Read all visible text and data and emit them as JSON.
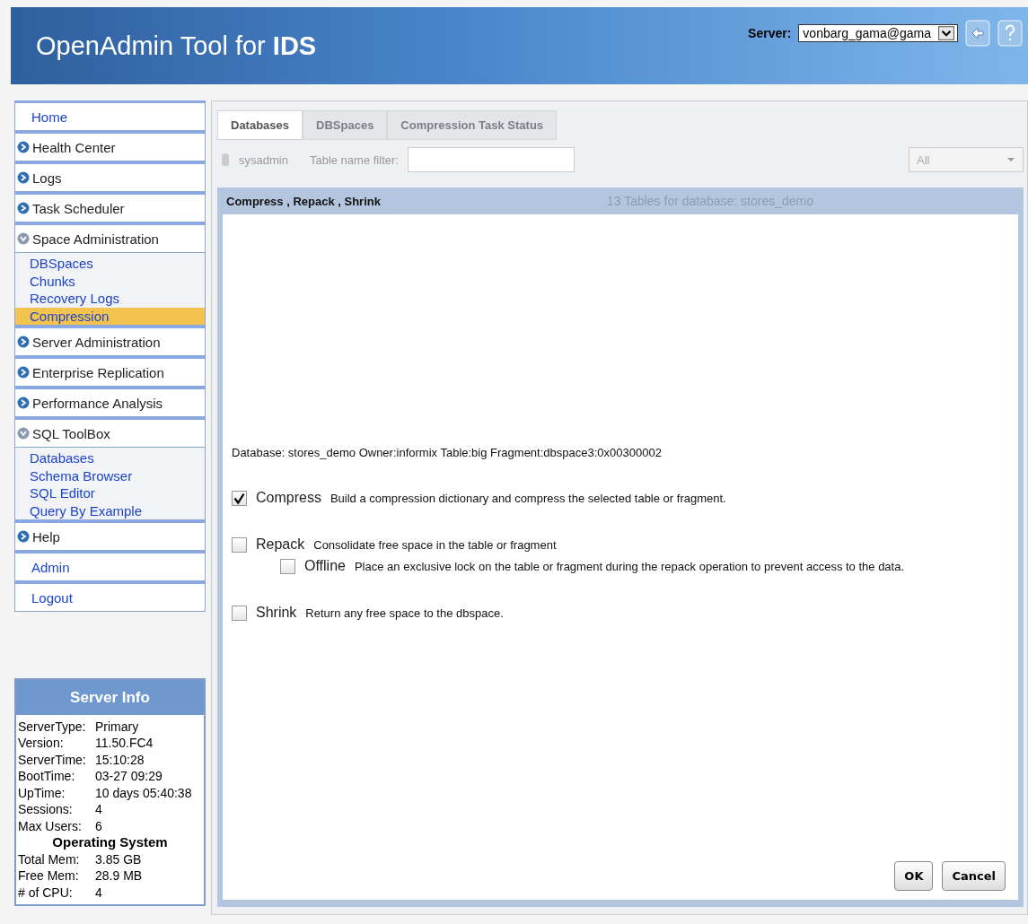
{
  "header": {
    "title_plain": "OpenAdmin Tool for ",
    "title_bold": "IDS",
    "server_label": "Server:",
    "server_value": "vonbarg_gama@gama"
  },
  "sidebar": {
    "items": [
      {
        "label": "Home",
        "kind": "link"
      },
      {
        "label": "Health Center",
        "kind": "section",
        "expanded": false
      },
      {
        "label": "Logs",
        "kind": "section",
        "expanded": false
      },
      {
        "label": "Task Scheduler",
        "kind": "section",
        "expanded": false
      },
      {
        "label": "Space Administration",
        "kind": "section",
        "expanded": true,
        "children": [
          {
            "label": "DBSpaces",
            "selected": false
          },
          {
            "label": "Chunks",
            "selected": false
          },
          {
            "label": "Recovery Logs",
            "selected": false
          },
          {
            "label": "Compression",
            "selected": true
          }
        ]
      },
      {
        "label": "Server Administration",
        "kind": "section",
        "expanded": false
      },
      {
        "label": "Enterprise Replication",
        "kind": "section",
        "expanded": false
      },
      {
        "label": "Performance Analysis",
        "kind": "section",
        "expanded": false
      },
      {
        "label": "SQL ToolBox",
        "kind": "section",
        "expanded": true,
        "children": [
          {
            "label": "Databases",
            "selected": false
          },
          {
            "label": "Schema Browser",
            "selected": false
          },
          {
            "label": "SQL Editor",
            "selected": false
          },
          {
            "label": "Query By Example",
            "selected": false
          }
        ]
      },
      {
        "label": "Help",
        "kind": "section",
        "expanded": false
      },
      {
        "label": "Admin",
        "kind": "link"
      },
      {
        "label": "Logout",
        "kind": "link"
      }
    ]
  },
  "server_info": {
    "title": "Server Info",
    "rows": [
      {
        "label": "ServerType:",
        "value": "Primary"
      },
      {
        "label": "Version:",
        "value": "11.50.FC4"
      },
      {
        "label": "ServerTime:",
        "value": "15:10:28"
      },
      {
        "label": "BootTime:",
        "value": "03-27 09:29"
      },
      {
        "label": "UpTime:",
        "value": "10 days 05:40:38"
      },
      {
        "label": "Sessions:",
        "value": "4"
      },
      {
        "label": "Max Users:",
        "value": "6"
      }
    ],
    "os_title": "Operating System",
    "os_rows": [
      {
        "label": "Total Mem:",
        "value": "3.85 GB"
      },
      {
        "label": "Free Mem:",
        "value": "28.9 MB"
      },
      {
        "label": "# of CPU:",
        "value": "4"
      }
    ]
  },
  "tabs": [
    {
      "label": "Databases",
      "selected": true
    },
    {
      "label": "DBSpaces",
      "selected": false
    },
    {
      "label": "Compression Task Status",
      "selected": false
    }
  ],
  "database": "sysadmin",
  "filter": {
    "label": "Table name filter:"
  },
  "filter_select": "All",
  "dialog": {
    "title": "Compress , Repack , Shrink",
    "underlay_heading": "13 Tables for database: stores_demo",
    "target": "Database: stores_demo Owner:informix Table:big Fragment:dbspace3:0x00300002",
    "options": [
      {
        "label": "Compress",
        "description": "Build a compression dictionary and compress the selected table or fragment.",
        "checked": true
      },
      {
        "label": "Repack",
        "description": "Consolidate free space in the table or fragment",
        "checked": false,
        "children": [
          {
            "label": "Offline",
            "description": "Place an exclusive lock on the table or fragment during the repack operation to prevent access to the data.",
            "checked": false
          }
        ]
      },
      {
        "label": "Shrink",
        "description": "Return any free space to the dbspace.",
        "checked": false
      }
    ],
    "buttons": [
      "OK",
      "Cancel"
    ]
  }
}
